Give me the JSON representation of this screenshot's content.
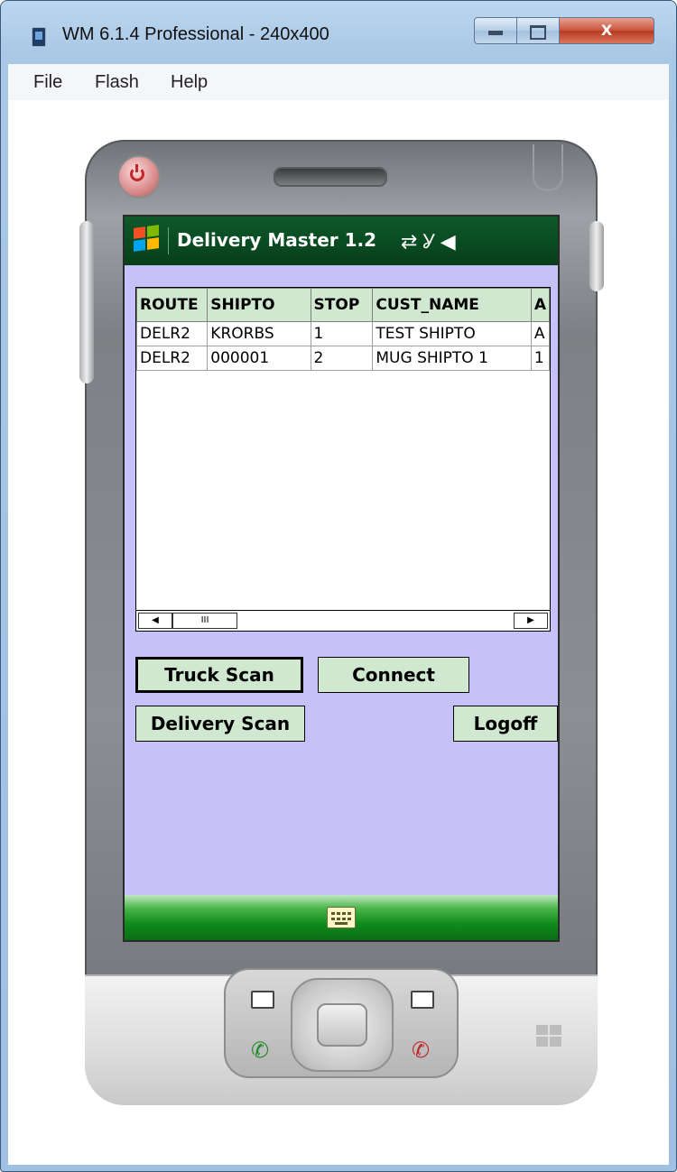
{
  "window": {
    "title": "WM 6.1.4 Professional - 240x400",
    "close_glyph": "X"
  },
  "menu": [
    "File",
    "Flash",
    "Help"
  ],
  "device": {
    "taskbar_title": "Delivery Master 1.2",
    "status_icons": [
      "sync-arrows-icon",
      "no-signal-icon",
      "speaker-muted-icon"
    ]
  },
  "grid": {
    "columns": [
      "ROUTE",
      "SHIPTO",
      "STOP",
      "CUST_NAME",
      "A"
    ],
    "rows": [
      [
        "DELR2",
        "KRORBS",
        "1",
        "TEST SHIPTO",
        "A"
      ],
      [
        "DELR2",
        "000001",
        "2",
        "MUG SHIPTO 1",
        "1"
      ]
    ],
    "scroll_thumb": "III",
    "left_arrow": "◀",
    "right_arrow": "▶"
  },
  "buttons": {
    "truck_scan": "Truck Scan",
    "connect": "Connect",
    "delivery_scan": "Delivery Scan",
    "logoff": "Logoff"
  },
  "colors": {
    "screen_bg": "#c6c1f9",
    "taskbar": "#0e5a2a",
    "button_bg": "#cfe8cf"
  }
}
